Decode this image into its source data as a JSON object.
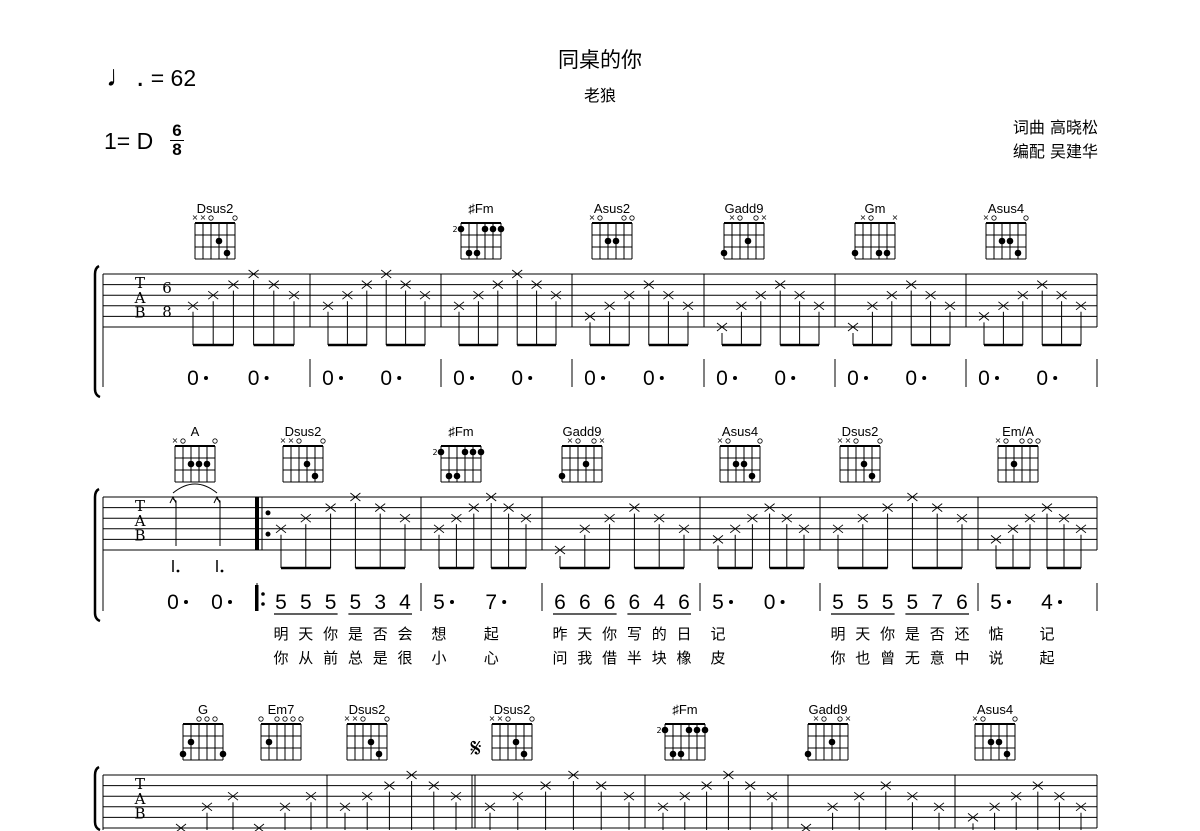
{
  "header": {
    "title": "同桌的你",
    "artist": "老狼",
    "tempo_label": "= 62",
    "tempo_note_icon": "dotted-quarter-note",
    "key_label": "1= D",
    "time_signature": {
      "top": "6",
      "bottom": "8"
    },
    "lyricist_composer": "词曲 高晓松",
    "arranger": "编配 吴建华"
  },
  "tab_clef": [
    "T",
    "A",
    "B"
  ],
  "systems": [
    {
      "show_time_sig": true,
      "measures": [
        {
          "tab": [
            4,
            3,
            2,
            1,
            2,
            3
          ],
          "jianpu": [
            "0·",
            "0·"
          ]
        },
        {
          "tab": [
            4,
            3,
            2,
            1,
            2,
            3
          ],
          "jianpu": [
            "0·",
            "0·"
          ]
        },
        {
          "tab": [
            4,
            3,
            2,
            1,
            2,
            3
          ],
          "jianpu": [
            "0·",
            "0·"
          ]
        },
        {
          "tab": [
            5,
            4,
            3,
            2,
            3,
            4
          ],
          "jianpu": [
            "0·",
            "0·"
          ]
        },
        {
          "tab": [
            6,
            4,
            3,
            2,
            3,
            4
          ],
          "jianpu": [
            "0·",
            "0·"
          ]
        },
        {
          "tab": [
            6,
            4,
            3,
            2,
            3,
            4
          ],
          "jianpu": [
            "0·",
            "0·"
          ]
        },
        {
          "tab": [
            5,
            4,
            3,
            2,
            3,
            4
          ],
          "jianpu": [
            "0·",
            "0·"
          ]
        }
      ],
      "chords": [
        {
          "name": "Dsus2",
          "frets": "xx0230",
          "measure": 0,
          "beat": 0
        },
        {
          "name": "♯Fm",
          "frets": "133111",
          "base": "2",
          "measure": 2,
          "beat": 0
        },
        {
          "name": "Asus2",
          "frets": "x02200",
          "measure": 3,
          "beat": 0
        },
        {
          "name": "Gadd9",
          "frets": "3x020x",
          "measure": 4,
          "beat": 0
        },
        {
          "name": "Gm",
          "frets": "3x033x",
          "measure": 5,
          "beat": 0
        },
        {
          "name": "Asus4",
          "frets": "x02230",
          "measure": 6,
          "beat": 0
        }
      ]
    },
    {
      "repeat_start_before_measure": 1,
      "measures": [
        {
          "strum": true,
          "jianpu": [
            "0·",
            "0·"
          ]
        },
        {
          "tab": [
            4,
            3,
            2,
            1,
            2,
            3
          ],
          "jianpu": [
            "5",
            "5",
            "5",
            "5",
            "3",
            "4"
          ],
          "underline": true,
          "lyrics": [
            [
              "明",
              "天",
              "你",
              "是",
              "否",
              "会"
            ],
            [
              "你",
              "从",
              "前",
              "总",
              "是",
              "很"
            ]
          ]
        },
        {
          "tab": [
            4,
            3,
            2,
            1,
            2,
            3
          ],
          "jianpu": [
            "5·",
            "7·"
          ],
          "lyrics": [
            [
              "想",
              "起"
            ],
            [
              "小",
              "心"
            ]
          ]
        },
        {
          "tab": [
            6,
            4,
            3,
            2,
            3,
            4
          ],
          "jianpu": [
            "6",
            "6",
            "6",
            "6",
            "4",
            "6"
          ],
          "underline": true,
          "lyrics": [
            [
              "昨",
              "天",
              "你",
              "写",
              "的",
              "日"
            ],
            [
              "问",
              "我",
              "借",
              "半",
              "块",
              "橡"
            ]
          ]
        },
        {
          "tab": [
            5,
            4,
            3,
            2,
            3,
            4
          ],
          "jianpu": [
            "5·",
            "0·"
          ],
          "lyrics": [
            [
              "记"
            ],
            [
              "皮"
            ]
          ]
        },
        {
          "tab": [
            4,
            3,
            2,
            1,
            2,
            3
          ],
          "jianpu": [
            "5",
            "5",
            "5",
            "5",
            "7",
            "6"
          ],
          "underline": true,
          "lyrics": [
            [
              "明",
              "天",
              "你",
              "是",
              "否",
              "还"
            ],
            [
              "你",
              "也",
              "曾",
              "无",
              "意",
              "中"
            ]
          ]
        },
        {
          "tab": [
            5,
            4,
            3,
            2,
            3,
            4
          ],
          "jianpu": [
            "5·",
            "4·"
          ],
          "lyrics": [
            [
              "惦",
              "记"
            ],
            [
              "说",
              "起"
            ]
          ]
        }
      ],
      "chords": [
        {
          "name": "A",
          "frets": "x02220",
          "measure": 0,
          "beat": 0
        },
        {
          "name": "Dsus2",
          "frets": "xx0230",
          "measure": 1,
          "beat": 0
        },
        {
          "name": "♯Fm",
          "frets": "133111",
          "base": "2",
          "measure": 2,
          "beat": 0
        },
        {
          "name": "Gadd9",
          "frets": "3x020x",
          "measure": 3,
          "beat": 0
        },
        {
          "name": "Asus4",
          "frets": "x02230",
          "measure": 4,
          "beat": 0
        },
        {
          "name": "Dsus2",
          "frets": "xx0230",
          "measure": 5,
          "beat": 0
        },
        {
          "name": "Em/A",
          "frets": "x02000",
          "measure": 6,
          "beat": 0
        }
      ]
    },
    {
      "double_bar_before_measure": 2,
      "segno_before_measure": 2,
      "measures": [
        {
          "tab": [
            6,
            4,
            3,
            6,
            4,
            3
          ]
        },
        {
          "tab": [
            4,
            3,
            2,
            1,
            2,
            3
          ]
        },
        {
          "tab": [
            4,
            3,
            2,
            1,
            2,
            3
          ]
        },
        {
          "tab": [
            4,
            3,
            2,
            1,
            2,
            3
          ]
        },
        {
          "tab": [
            6,
            4,
            3,
            2,
            3,
            4
          ]
        },
        {
          "tab": [
            5,
            4,
            3,
            2,
            3,
            4
          ]
        }
      ],
      "chords": [
        {
          "name": "G",
          "frets": "320003",
          "measure": 0,
          "beat": 0
        },
        {
          "name": "Em7",
          "frets": "020000",
          "measure": 0,
          "beat": 1
        },
        {
          "name": "Dsus2",
          "frets": "xx0230",
          "measure": 1,
          "beat": 0
        },
        {
          "name": "Dsus2",
          "frets": "xx0230",
          "measure": 2,
          "beat": 0
        },
        {
          "name": "♯Fm",
          "frets": "133111",
          "base": "2",
          "measure": 3,
          "beat": 0
        },
        {
          "name": "Gadd9",
          "frets": "3x020x",
          "measure": 4,
          "beat": 0
        },
        {
          "name": "Asus4",
          "frets": "x02230",
          "measure": 5,
          "beat": 0
        }
      ]
    }
  ]
}
